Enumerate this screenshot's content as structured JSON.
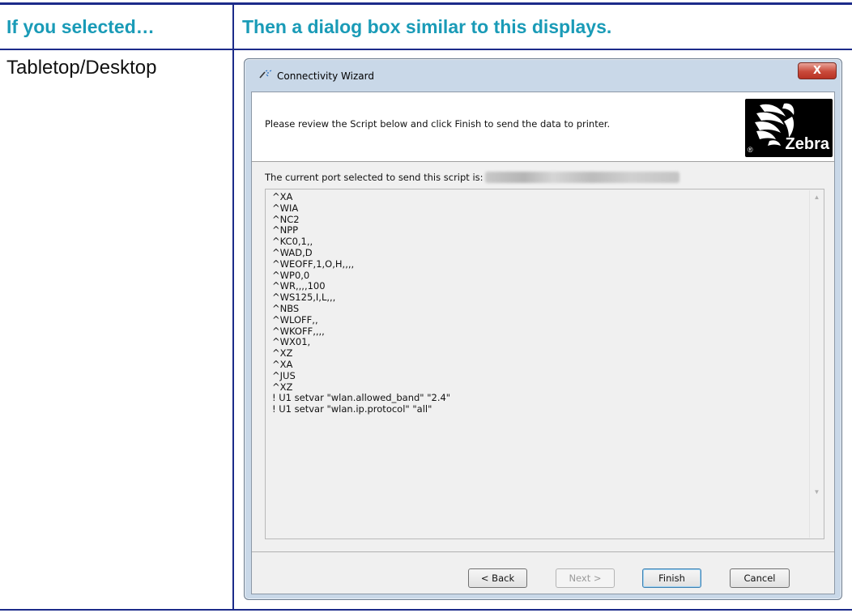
{
  "table": {
    "header_left": "If you selected…",
    "header_right": "Then a dialog box similar to this displays.",
    "row_label": "Tabletop/Desktop"
  },
  "dialog": {
    "title": "Connectivity Wizard",
    "close_label": "X",
    "instruction": "Please review the Script below and click Finish to send the data to printer.",
    "logo": {
      "word": "Zebra",
      "registered": "®"
    },
    "port_label": "The current port selected to send this script is:",
    "script_lines": [
      "^XA",
      "^WIA",
      "^NC2",
      "^NPP",
      "^KC0,1,,",
      "^WAD,D",
      "^WEOFF,1,O,H,,,,",
      "^WP0,0",
      "^WR,,,,100",
      "^WS125,I,L,,,",
      "^NBS",
      "^WLOFF,,",
      "^WKOFF,,,,",
      "^WX01,",
      "^XZ",
      "^XA",
      "^JUS",
      "^XZ",
      "! U1 setvar \"wlan.allowed_band\" \"2.4\"",
      "! U1 setvar \"wlan.ip.protocol\" \"all\""
    ],
    "buttons": {
      "back": "< Back",
      "next": "Next >",
      "finish": "Finish",
      "cancel": "Cancel"
    }
  },
  "colors": {
    "header_text": "#1a9bb7",
    "rule": "#1c2b8a",
    "window_frame": "#c9d8e8",
    "close_button": "#c94a3a"
  }
}
